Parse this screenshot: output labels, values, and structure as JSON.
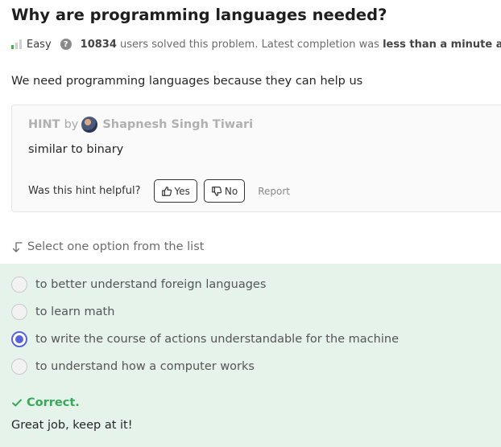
{
  "problem": {
    "title": "Why are programming languages needed?",
    "difficulty": "Easy",
    "solved_count": "10834",
    "solved_text": " users solved this problem. Latest completion was ",
    "latest_completion": "less than a minute ago",
    "latest_suffix": ".",
    "description": "We need programming languages because they can help us"
  },
  "hint": {
    "label": "HINT",
    "by": "by",
    "author": "Shapnesh Singh Tiwari",
    "text": "similar to binary",
    "helpful_question": "Was this hint helpful?",
    "yes_label": "Yes",
    "no_label": "No",
    "report_label": "Report"
  },
  "quiz": {
    "instruction": "Select one option from the list",
    "options": [
      {
        "label": "to better understand foreign languages",
        "selected": false
      },
      {
        "label": "to learn math",
        "selected": false
      },
      {
        "label": "to write the course of actions understandable for the machine",
        "selected": true
      },
      {
        "label": "to understand how a computer works",
        "selected": false
      }
    ],
    "result_title": "Correct.",
    "result_message": "Great job, keep at it!"
  },
  "colors": {
    "correct_green": "#3aa85a",
    "answer_bg": "#e5f3eb",
    "radio_selected": "#5863d8",
    "difficulty_bar": "#4caf50"
  },
  "icons": {
    "difficulty": "difficulty-bars-icon",
    "help": "question-circle-icon",
    "thumbs_up": "thumbs-up-icon",
    "thumbs_down": "thumbs-down-icon",
    "select": "arrow-down-turn-icon",
    "check": "check-icon"
  }
}
